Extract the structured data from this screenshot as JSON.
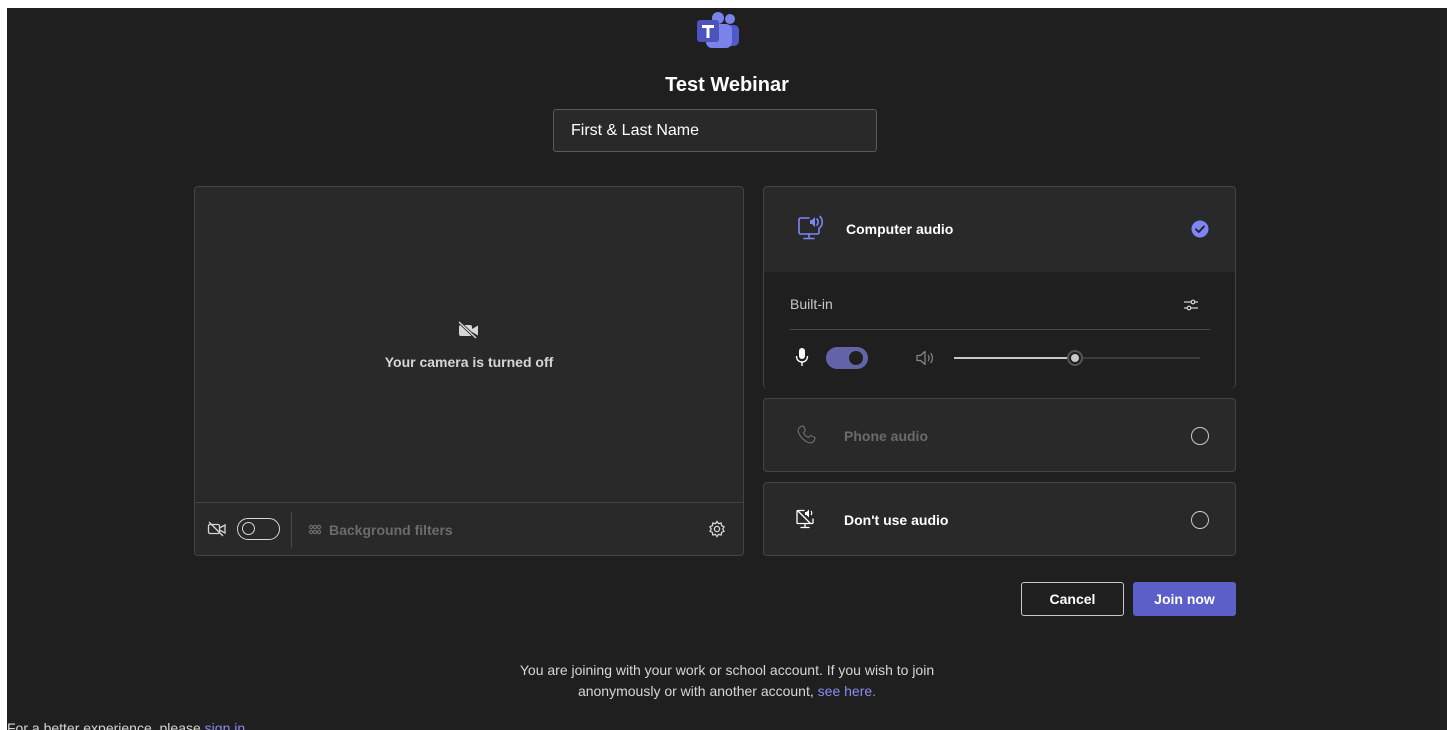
{
  "meeting": {
    "title": "Test Webinar"
  },
  "name_input": {
    "placeholder": "First & Last Name"
  },
  "video": {
    "camera_off_text": "Your camera is turned off",
    "background_filters_label": "Background filters",
    "camera_on": false
  },
  "audio": {
    "options": [
      {
        "label": "Computer audio",
        "selected": true
      },
      {
        "label": "Phone audio",
        "selected": false
      },
      {
        "label": "Don't use audio",
        "selected": false
      }
    ],
    "device_name": "Built-in",
    "mic_on": true,
    "volume_percent": 49
  },
  "buttons": {
    "cancel": "Cancel",
    "join": "Join now"
  },
  "footer": {
    "line1": "You are joining with your work or school account. If you wish to join",
    "line2": "anonymously or with another account,",
    "link": "see here."
  },
  "bottom_note": {
    "text": "For a better experience, please",
    "link": "sign in"
  },
  "colors": {
    "accent": "#6264a7",
    "button_primary": "#5b5fc7",
    "background": "#1f1f1f",
    "link": "#8b8cf0"
  }
}
